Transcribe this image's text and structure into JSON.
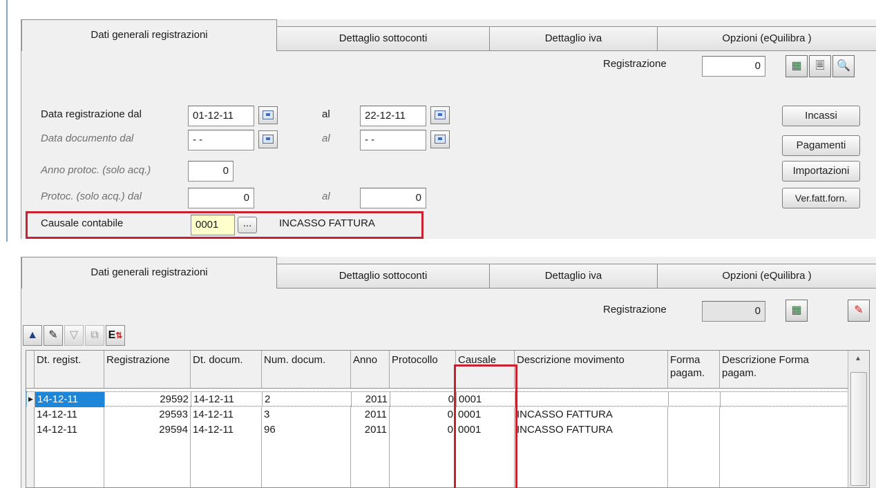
{
  "top": {
    "tabs": [
      "Dati generali registrazioni",
      "Dettaglio sottoconti",
      "Dettaglio iva",
      "Opzioni (eQuilibra )"
    ],
    "registrazione_label": "Registrazione",
    "registrazione_value": "0",
    "data_reg_label": "Data registrazione  dal",
    "data_reg_dal": "01-12-11",
    "data_reg_al_label": "al",
    "data_reg_al": "22-12-11",
    "data_doc_label": "Data documento   dal",
    "data_doc_dal": "- -",
    "data_doc_al_label": "al",
    "data_doc_al": "- -",
    "anno_label": "Anno protoc. (solo acq.)",
    "anno_value": "0",
    "protoc_label": "Protoc. (solo acq.)  dal",
    "protoc_dal": "0",
    "protoc_al_label": "al",
    "protoc_al": "0",
    "causale_label": "Causale contabile",
    "causale_code": "0001",
    "causale_browse": "...",
    "causale_desc": "INCASSO FATTURA",
    "buttons": [
      "Incassi",
      "Pagamenti",
      "Importazioni",
      "Ver.fatt.forn."
    ]
  },
  "bottom": {
    "tabs": [
      "Dati generali registrazioni",
      "Dettaglio sottoconti",
      "Dettaglio iva",
      "Opzioni (eQuilibra )"
    ],
    "registrazione_label": "Registrazione",
    "registrazione_value": "0",
    "headers": [
      "Dt. regist.",
      "Registrazione",
      "Dt. docum.",
      "Num. docum.",
      "Anno",
      "Protocollo",
      "Causale",
      "Descrizione movimento",
      "Forma pagam.",
      "Descrizione Forma pagam."
    ],
    "rows": [
      [
        "14-12-11",
        "29592",
        "14-12-11",
        "2",
        "2011",
        "0",
        "0001",
        "",
        "",
        ""
      ],
      [
        "14-12-11",
        "29593",
        "14-12-11",
        "3",
        "2011",
        "0",
        "0001",
        "INCASSO FATTURA",
        "",
        ""
      ],
      [
        "14-12-11",
        "29594",
        "14-12-11",
        "96",
        "2011",
        "0",
        "0001",
        "INCASSO FATTURA",
        "",
        ""
      ]
    ]
  }
}
